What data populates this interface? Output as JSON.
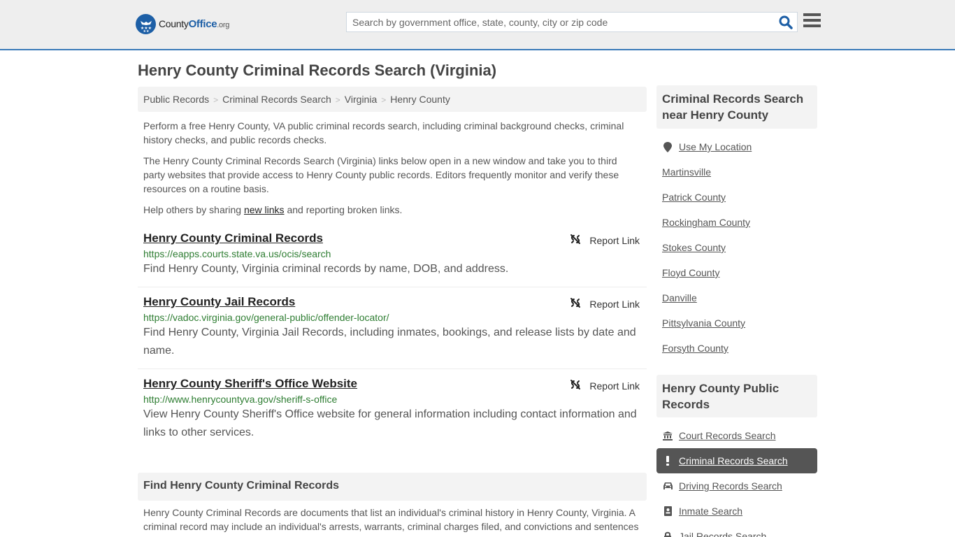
{
  "header": {
    "logo": {
      "brand_part1": "County",
      "brand_part2": "Office",
      "brand_part3": ".org"
    },
    "search": {
      "placeholder": "Search by government office, state, county, city or zip code",
      "value": ""
    },
    "colors": {
      "accent": "#1d5fa6",
      "header_bg": "#eeeeee",
      "header_border": "#3a7ab8"
    }
  },
  "main": {
    "title": "Henry County Criminal Records Search (Virginia)",
    "breadcrumb": [
      "Public Records",
      "Criminal Records Search",
      "Virginia",
      "Henry County"
    ],
    "intro": {
      "p1": "Perform a free Henry County, VA public criminal records search, including criminal background checks, criminal history checks, and public records checks.",
      "p2": "The Henry County Criminal Records Search (Virginia) links below open in a new window and take you to third party websites that provide access to Henry County public records. Editors frequently monitor and verify these resources on a routine basis.",
      "p3_before": "Help others by sharing ",
      "p3_link": "new links",
      "p3_after": " and reporting broken links."
    },
    "links": [
      {
        "title": "Henry County Criminal Records",
        "url": "https://eapps.courts.state.va.us/ocis/search",
        "desc": "Find Henry County, Virginia criminal records by name, DOB, and address.",
        "report": "Report Link"
      },
      {
        "title": "Henry County Jail Records",
        "url": "https://vadoc.virginia.gov/general-public/offender-locator/",
        "desc": "Find Henry County, Virginia Jail Records, including inmates, bookings, and release lists by date and name.",
        "report": "Report Link"
      },
      {
        "title": "Henry County Sheriff's Office Website",
        "url": "http://www.henrycountyva.gov/sheriff-s-office",
        "desc": "View Henry County Sheriff's Office website for general information including contact information and links to other services.",
        "report": "Report Link"
      }
    ],
    "find_section": {
      "heading": "Find Henry County Criminal Records",
      "text": "Henry County Criminal Records are documents that list an individual's criminal history in Henry County, Virginia. A criminal record may include an individual's arrests, warrants, criminal charges filed, and convictions and sentences"
    }
  },
  "sidebar": {
    "nearby": {
      "heading": "Criminal Records Search near Henry County",
      "use_location": "Use My Location",
      "items": [
        "Martinsville",
        "Patrick County",
        "Rockingham County",
        "Stokes County",
        "Floyd County",
        "Danville",
        "Pittsylvania County",
        "Forsyth County"
      ]
    },
    "public_records": {
      "heading": "Henry County Public Records",
      "items": [
        {
          "label": "Court Records Search",
          "icon": "bank-icon",
          "active": false
        },
        {
          "label": "Criminal Records Search",
          "icon": "exclamation-icon",
          "active": true
        },
        {
          "label": "Driving Records Search",
          "icon": "car-icon",
          "active": false
        },
        {
          "label": "Inmate Search",
          "icon": "id-badge-icon",
          "active": false
        },
        {
          "label": "Jail Records Search",
          "icon": "lock-icon",
          "active": false
        }
      ]
    }
  }
}
